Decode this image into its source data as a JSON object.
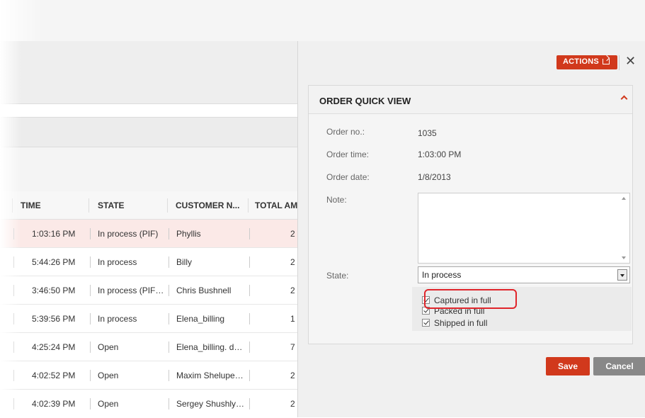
{
  "table": {
    "headers": [
      "TIME",
      "STATE",
      "CUSTOMER N...",
      "TOTAL AM"
    ],
    "rows": [
      {
        "time": "1:03:16 PM",
        "state": "In process (PIF)",
        "customer": "Phyllis",
        "total": "2",
        "selected": true
      },
      {
        "time": "5:44:26 PM",
        "state": "In process",
        "customer": "Billy",
        "total": "2"
      },
      {
        "time": "3:46:50 PM",
        "state": "In process (PIF…",
        "customer": "Chris Bushnell",
        "total": "2"
      },
      {
        "time": "5:39:56 PM",
        "state": "In process",
        "customer": "Elena_billing",
        "total": "1"
      },
      {
        "time": "4:25:24 PM",
        "state": "Open",
        "customer": "Elena_billing. d…",
        "total": "7"
      },
      {
        "time": "4:02:52 PM",
        "state": "Open",
        "customer": "Maxim Shelupe…",
        "total": "2"
      },
      {
        "time": "4:02:39 PM",
        "state": "Open",
        "customer": "Sergey Shushly…",
        "total": "2"
      }
    ]
  },
  "panel": {
    "actions_label": "ACTIONS",
    "close_glyph": "✕",
    "title": "ORDER QUICK VIEW",
    "fields": {
      "order_no_label": "Order no.:",
      "order_no": "1035",
      "order_time_label": "Order time:",
      "order_time": "1:03:00 PM",
      "order_date_label": "Order date:",
      "order_date": "1/8/2013",
      "note_label": "Note:",
      "note_value": "",
      "state_label": "State:",
      "state_value": "In process"
    },
    "checkboxes": [
      {
        "label": "Captured in full",
        "checked": true
      },
      {
        "label": "Packed in full",
        "checked": true
      },
      {
        "label": "Shipped in full",
        "checked": true
      }
    ],
    "save_label": "Save",
    "cancel_label": "Cancel"
  },
  "colors": {
    "accent": "#d1391c",
    "selected_row": "#fbe9e7",
    "highlight": "#e0252b"
  },
  "icons": [
    "external-link-icon",
    "close-icon",
    "chevron-up-icon",
    "dropdown-arrow-icon",
    "checkbox-icon"
  ]
}
